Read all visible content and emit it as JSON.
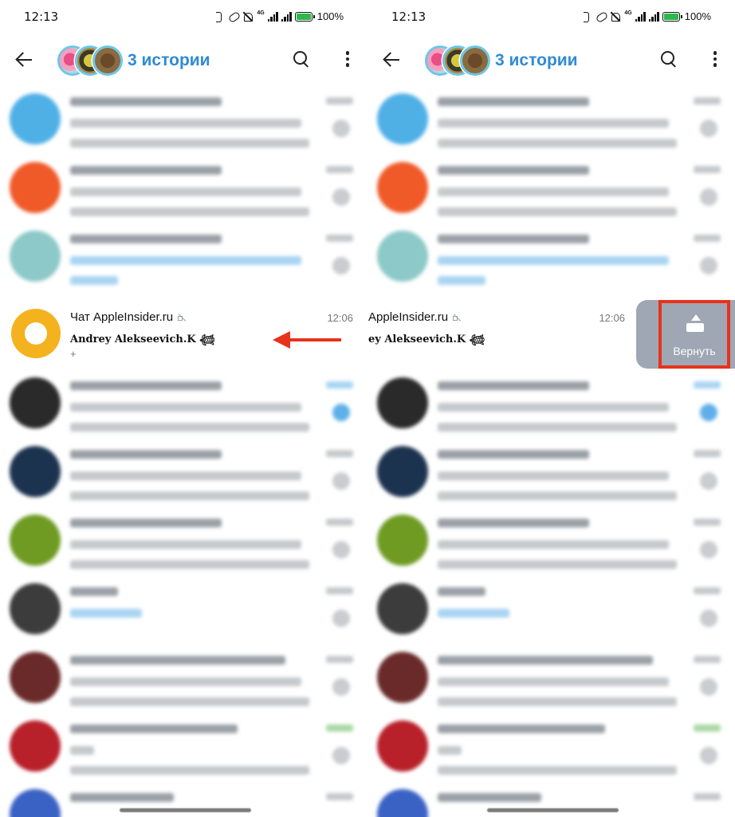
{
  "panels": [
    {
      "status": {
        "time": "12:13",
        "network": "4G",
        "battery": "100%"
      },
      "header": {
        "stories_label": "3 истории"
      },
      "highlight_chat": {
        "title": "Чат AppleInsider.ru",
        "time": "12:06",
        "sender": "Andrey Alekseevich.K 𓆉",
        "preview": "+"
      }
    },
    {
      "status": {
        "time": "12:13",
        "network": "4G",
        "battery": "100%"
      },
      "header": {
        "stories_label": "3 истории"
      },
      "highlight_chat": {
        "title": "AppleInsider.ru",
        "time": "12:06",
        "sender": "ey Alekseevich.K 𓆉"
      },
      "swipe_action": {
        "label": "Вернуть",
        "icon": "unarchive-icon"
      }
    }
  ],
  "colors": {
    "accent": "#2f8bd4",
    "annotation": "#e8321c",
    "swipe_bg": "#9ea7b3",
    "chat_avatar": "#f4b21f"
  }
}
